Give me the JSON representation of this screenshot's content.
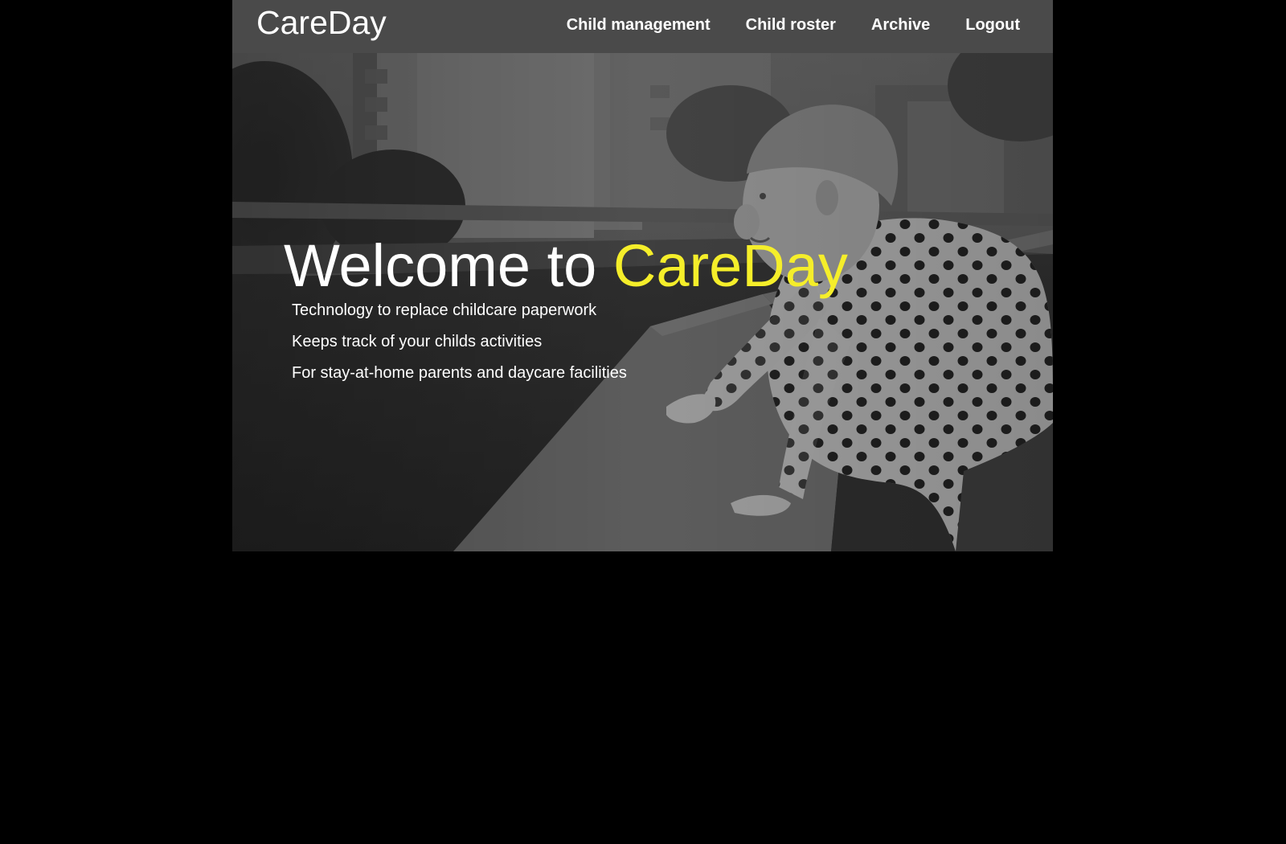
{
  "app": {
    "brand": "CareDay",
    "colors": {
      "page_background": "#000000",
      "navbar_background": "#4a4a4a",
      "accent": "#f5ee2a",
      "text": "#ffffff"
    }
  },
  "nav": {
    "items": [
      {
        "label": "Child management"
      },
      {
        "label": "Child roster"
      },
      {
        "label": "Archive"
      },
      {
        "label": "Logout"
      }
    ]
  },
  "hero": {
    "title_prefix": "Welcome to ",
    "title_accent": "CareDay",
    "taglines": [
      "Technology to replace childcare paperwork",
      "Keeps track of your childs activities",
      "For stay-at-home parents and daycare facilities"
    ],
    "background_image": "grayscale-photo-toddler-leaning-on-concrete-ledge"
  }
}
